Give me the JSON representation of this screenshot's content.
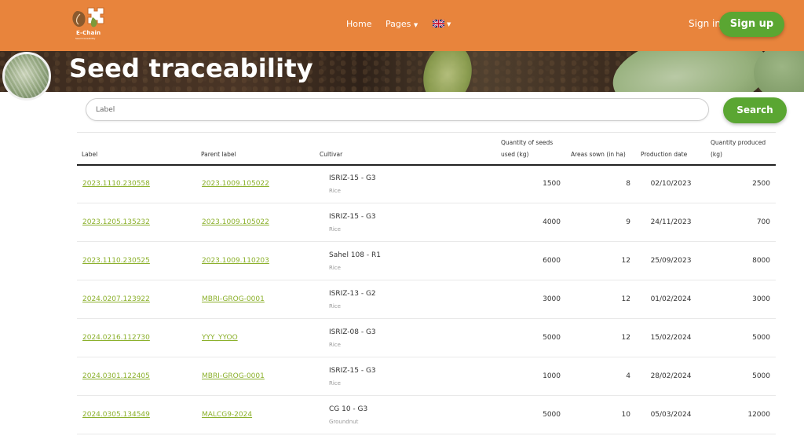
{
  "header": {
    "logo_text": "E-Chain",
    "logo_subtext": "Seed traceability",
    "nav": {
      "home": "Home",
      "pages": "Pages"
    },
    "sign_in": "Sign in",
    "sign_up": "Sign up"
  },
  "banner": {
    "title": "Seed traceability"
  },
  "search": {
    "placeholder": "Label",
    "button": "Search"
  },
  "table": {
    "headers": {
      "label": "Label",
      "parent_label": "Parent label",
      "cultivar": "Cultivar",
      "seeds_used_line1": "Quantity of seeds",
      "seeds_used_line2": "used (kg)",
      "areas": "Areas sown (in ha)",
      "production_date": "Production date",
      "produced_line1": "Quantity produced",
      "produced_line2": "(kg)"
    },
    "rows": [
      {
        "label": "2023.1110.230558",
        "parent": "2023.1009.105022",
        "cultivar": "ISRIZ-15 - G3",
        "crop": "Rice",
        "seeds": "1500",
        "area": "8",
        "date": "02/10/2023",
        "produced": "2500"
      },
      {
        "label": "2023.1205.135232",
        "parent": "2023.1009.105022",
        "cultivar": "ISRIZ-15 - G3",
        "crop": "Rice",
        "seeds": "4000",
        "area": "9",
        "date": "24/11/2023",
        "produced": "700"
      },
      {
        "label": "2023.1110.230525",
        "parent": "2023.1009.110203",
        "cultivar": "Sahel 108 - R1",
        "crop": "Rice",
        "seeds": "6000",
        "area": "12",
        "date": "25/09/2023",
        "produced": "8000"
      },
      {
        "label": "2024.0207.123922",
        "parent": "MBRI-GROG-0001",
        "cultivar": "ISRIZ-13 - G2",
        "crop": "Rice",
        "seeds": "3000",
        "area": "12",
        "date": "01/02/2024",
        "produced": "3000"
      },
      {
        "label": "2024.0216.112730",
        "parent": "YYY_YYOO",
        "cultivar": "ISRIZ-08 - G3",
        "crop": "Rice",
        "seeds": "5000",
        "area": "12",
        "date": "15/02/2024",
        "produced": "5000"
      },
      {
        "label": "2024.0301.122405",
        "parent": "MBRI-GROG-0001",
        "cultivar": "ISRIZ-15 - G3",
        "crop": "Rice",
        "seeds": "1000",
        "area": "4",
        "date": "28/02/2024",
        "produced": "5000"
      },
      {
        "label": "2024.0305.134549",
        "parent": "MALCG9-2024",
        "cultivar": "CG 10 - G3",
        "crop": "Groundnut",
        "seeds": "5000",
        "area": "10",
        "date": "05/03/2024",
        "produced": "12000"
      }
    ]
  },
  "colors": {
    "header_orange": "#e8843c",
    "accent_green": "#5aa632",
    "link_green": "#8bb02b"
  }
}
